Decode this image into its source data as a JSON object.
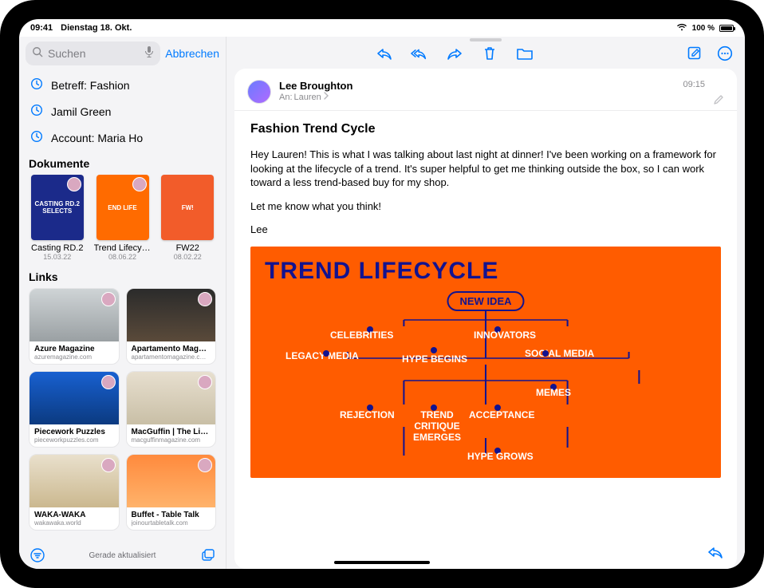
{
  "status": {
    "time": "09:41",
    "date": "Dienstag 18. Okt.",
    "battery": "100 %"
  },
  "sidebar": {
    "search_placeholder": "Suchen",
    "cancel_label": "Abbrechen",
    "suggestions": [
      {
        "label": "Betreff: Fashion"
      },
      {
        "label": "Jamil Green"
      },
      {
        "label": "Account: Maria Ho"
      }
    ],
    "documents_header": "Dokumente",
    "documents": [
      {
        "title": "Casting RD.2",
        "date": "15.03.22",
        "thumb_text": "CASTING RD.2 SELECTS",
        "style": "blue"
      },
      {
        "title": "Trend Lifecycle",
        "date": "08.06.22",
        "thumb_text": "END LIFE",
        "style": "orange"
      },
      {
        "title": "FW22",
        "date": "08.02.22",
        "thumb_text": "FW!",
        "style": "mag"
      }
    ],
    "links_header": "Links",
    "links": [
      {
        "title": "Azure Magazine",
        "url": "azuremagazine.com",
        "g": "g1"
      },
      {
        "title": "Apartamento Maga…",
        "url": "apartamentomagazine.c…",
        "g": "g2"
      },
      {
        "title": "Piecework Puzzles",
        "url": "pieceworkpuzzles.com",
        "g": "g3"
      },
      {
        "title": "MacGuffin | The Lif…",
        "url": "macguffinmagazine.com",
        "g": "g4"
      },
      {
        "title": "WAKA-WAKA",
        "url": "wakawaka.world",
        "g": "g5"
      },
      {
        "title": "Buffet - Table Talk",
        "url": "joinourtabletalk.com",
        "g": "g6"
      }
    ],
    "footer_status": "Gerade aktualisiert"
  },
  "message": {
    "sender": "Lee Broughton",
    "to_label": "An:",
    "to_name": "Lauren",
    "time": "09:15",
    "subject": "Fashion Trend Cycle",
    "body_p1": "Hey Lauren! This is what I was talking about last night at dinner! I've been working on a framework for looking at the lifecycle of a trend. It's super helpful to get me thinking outside the box, so I can work toward a less trend-based buy for my shop.",
    "body_p2": "Let me know what you think!",
    "body_p3": "Lee",
    "graphic": {
      "title": "TREND LIFECYCLE",
      "new_idea": "NEW IDEA",
      "celebrities": "CELEBRITIES",
      "innovators": "INNOVATORS",
      "legacy_media": "LEGACY MEDIA",
      "hype_begins": "HYPE BEGINS",
      "social_media": "SOCIAL MEDIA",
      "memes": "MEMES",
      "rejection": "REJECTION",
      "trend_critique": "TREND CRITIQUE EMERGES",
      "acceptance": "ACCEPTANCE",
      "hype_grows": "HYPE GROWS"
    }
  }
}
